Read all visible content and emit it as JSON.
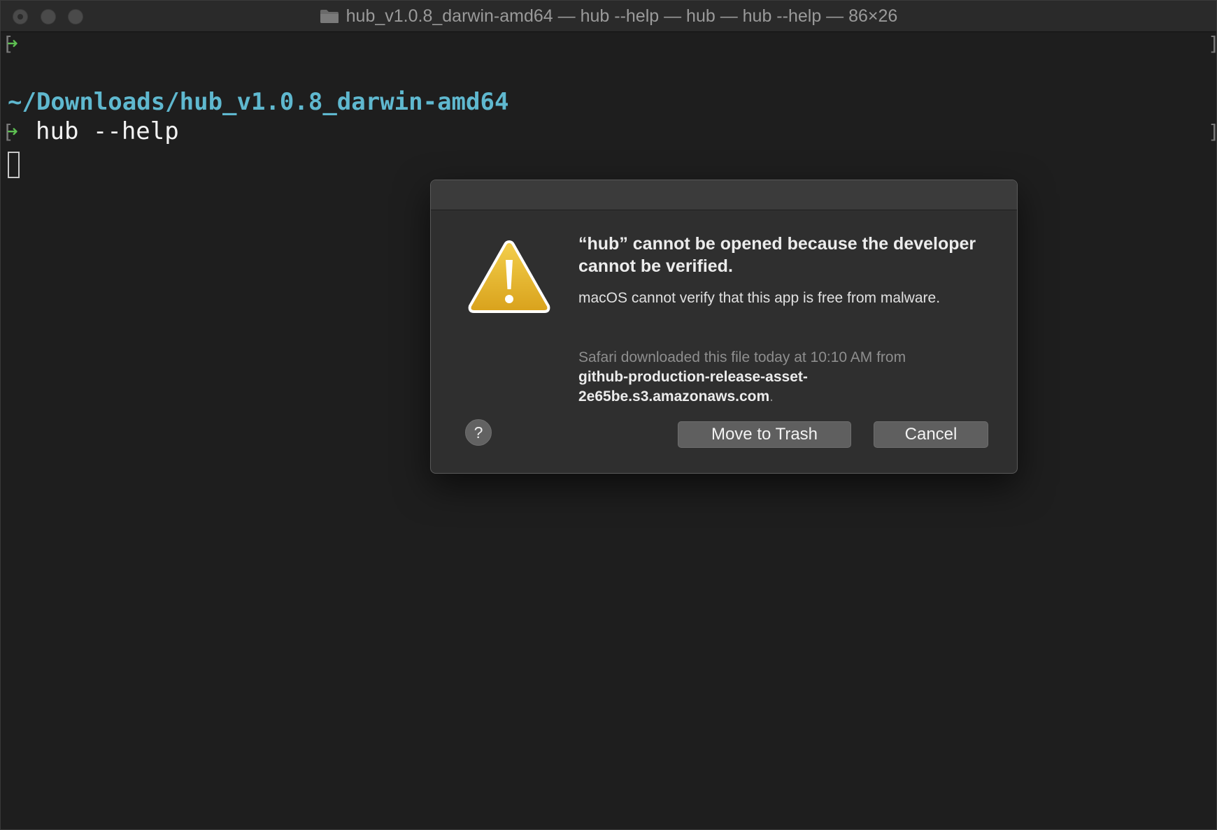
{
  "window": {
    "title": "hub_v1.0.8_darwin-amd64 — hub --help — hub — hub --help — 86×26"
  },
  "terminal": {
    "prompt_symbol": "➜",
    "bracket_open": "[",
    "bracket_close": "]",
    "cwd": "~/Downloads/hub_v1.0.8_darwin-amd64",
    "command": "hub --help"
  },
  "dialog": {
    "title": "“hub” cannot be opened because the developer cannot be verified.",
    "message": "macOS cannot verify that this app is free from malware.",
    "source_intro": "Safari downloaded this file today at 10:10 AM from",
    "source_host": "github-production-release-asset-2e65be.s3.amazonaws.com",
    "source_end": ".",
    "help_label": "?",
    "move_to_trash_label": "Move to Trash",
    "cancel_label": "Cancel"
  },
  "colors": {
    "terminal_bg": "#1e1e1e",
    "prompt_arrow": "#5ec152",
    "cwd_text": "#5fb8cf",
    "warning_yellow": "#e6b422"
  },
  "icons": {
    "window_close": "close-icon",
    "window_minimize": "minimize-icon",
    "window_zoom": "zoom-icon",
    "title_folder": "folder-icon",
    "dialog_warning": "warning-triangle-icon"
  }
}
